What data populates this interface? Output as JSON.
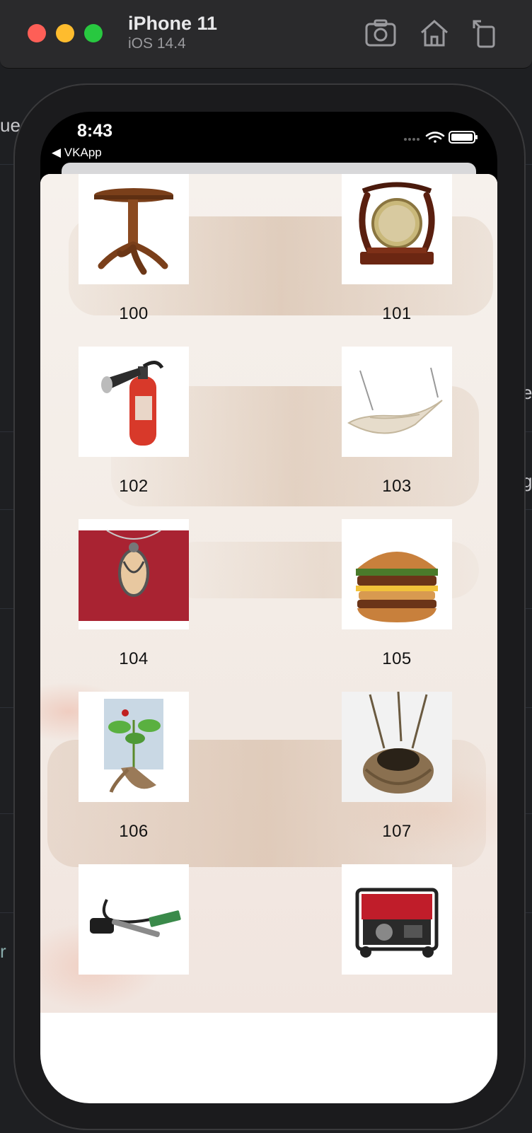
{
  "simulator": {
    "device_name": "iPhone 11",
    "os_version": "iOS 14.4",
    "toolbar": [
      {
        "name": "screenshot-icon"
      },
      {
        "name": "home-icon"
      },
      {
        "name": "rotate-icon"
      }
    ]
  },
  "status_bar": {
    "time": "8:43",
    "back_app": "◀ VKApp"
  },
  "background_fragments": {
    "left_top": "ue",
    "right_mid": "e",
    "right_lower": "g",
    "left_bottom": "r"
  },
  "items": [
    {
      "label": "100",
      "icon": "table-icon"
    },
    {
      "label": "101",
      "icon": "gong-icon"
    },
    {
      "label": "102",
      "icon": "fire-extinguisher-icon"
    },
    {
      "label": "103",
      "icon": "hammock-icon"
    },
    {
      "label": "104",
      "icon": "pendant-icon"
    },
    {
      "label": "105",
      "icon": "burger-icon"
    },
    {
      "label": "106",
      "icon": "ginseng-icon"
    },
    {
      "label": "107",
      "icon": "nest-icon"
    },
    {
      "label": "",
      "icon": "fire-starter-icon"
    },
    {
      "label": "",
      "icon": "generator-icon"
    }
  ],
  "colors": {
    "accent_brown": "#8b5a2b",
    "label_text": "#111111"
  }
}
